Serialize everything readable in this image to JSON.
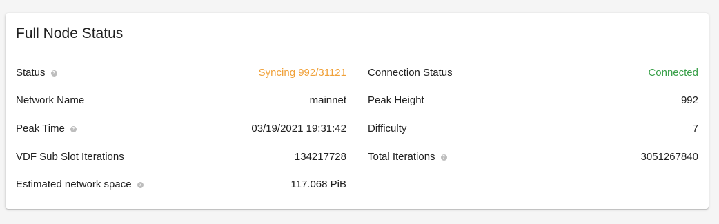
{
  "card": {
    "title": "Full Node Status"
  },
  "left_rows": [
    {
      "label": "Status",
      "value": "Syncing 992/31121",
      "help": true,
      "status": "syncing"
    },
    {
      "label": "Network Name",
      "value": "mainnet",
      "help": false
    },
    {
      "label": "Peak Time",
      "value": "03/19/2021 19:31:42",
      "help": true
    },
    {
      "label": "VDF Sub Slot Iterations",
      "value": "134217728",
      "help": false
    },
    {
      "label": "Estimated network space",
      "value": "117.068 PiB",
      "help": true
    }
  ],
  "right_rows": [
    {
      "label": "Connection Status",
      "value": "Connected",
      "help": false,
      "status": "connected"
    },
    {
      "label": "Peak Height",
      "value": "992",
      "help": false
    },
    {
      "label": "Difficulty",
      "value": "7",
      "help": false
    },
    {
      "label": "Total Iterations",
      "value": "3051267840",
      "help": true
    }
  ],
  "colors": {
    "syncing": "#f0a13a",
    "connected": "#3aa04a"
  },
  "icons": {
    "help": "help-circle-icon"
  }
}
